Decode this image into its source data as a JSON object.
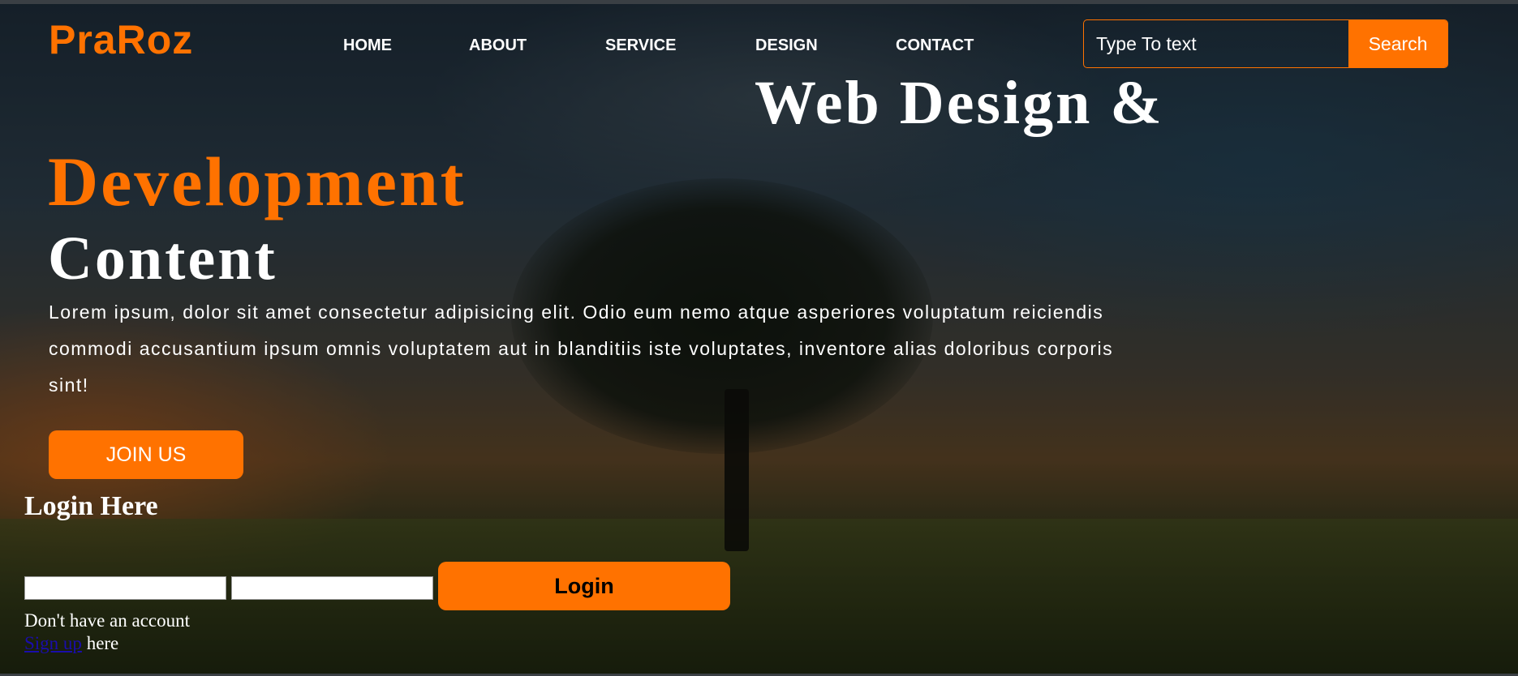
{
  "brand": {
    "name": "PraRoz",
    "accent_color": "#ff7200"
  },
  "nav": {
    "items": [
      {
        "label": "HOME"
      },
      {
        "label": "ABOUT"
      },
      {
        "label": "SERVICE"
      },
      {
        "label": "DESIGN"
      },
      {
        "label": "CONTACT"
      }
    ]
  },
  "search": {
    "placeholder": "Type To text",
    "button_label": "Search"
  },
  "hero": {
    "line1": "Web Design &",
    "line2": "Development",
    "line3": "Content",
    "paragraph": "Lorem ipsum, dolor sit amet consectetur adipisicing elit. Odio eum nemo atque asperiores voluptatum reiciendis commodi accusantium ipsum omnis voluptatem aut in blanditiis iste voluptates, inventore alias doloribus corporis sint!",
    "cta_label": "JOIN US"
  },
  "login": {
    "title": "Login Here",
    "button_label": "Login",
    "no_account_text": "Don't have an account",
    "signup_link": "Sign up",
    "signup_suffix": " here"
  }
}
